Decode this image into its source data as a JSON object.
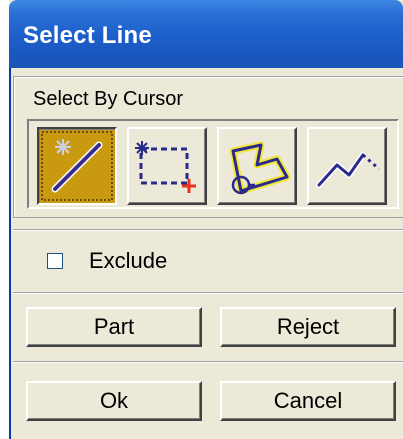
{
  "window": {
    "title": "Select Line"
  },
  "select_group": {
    "label": "Select By Cursor",
    "tools": [
      {
        "name": "line",
        "icon": "single-line-pick-icon",
        "active": true
      },
      {
        "name": "box",
        "icon": "box-select-icon",
        "active": false
      },
      {
        "name": "polygon",
        "icon": "polygon-select-icon",
        "active": false
      },
      {
        "name": "polyline",
        "icon": "polyline-select-icon",
        "active": false
      }
    ]
  },
  "exclude": {
    "label": "Exclude",
    "checked": false
  },
  "buttons": {
    "part": "Part",
    "reject": "Reject",
    "ok": "Ok",
    "cancel": "Cancel"
  },
  "colors": {
    "titlebar": "#1c5ec9",
    "dialog_bg": "#ece9d8",
    "active_tool": "#c99a10"
  }
}
